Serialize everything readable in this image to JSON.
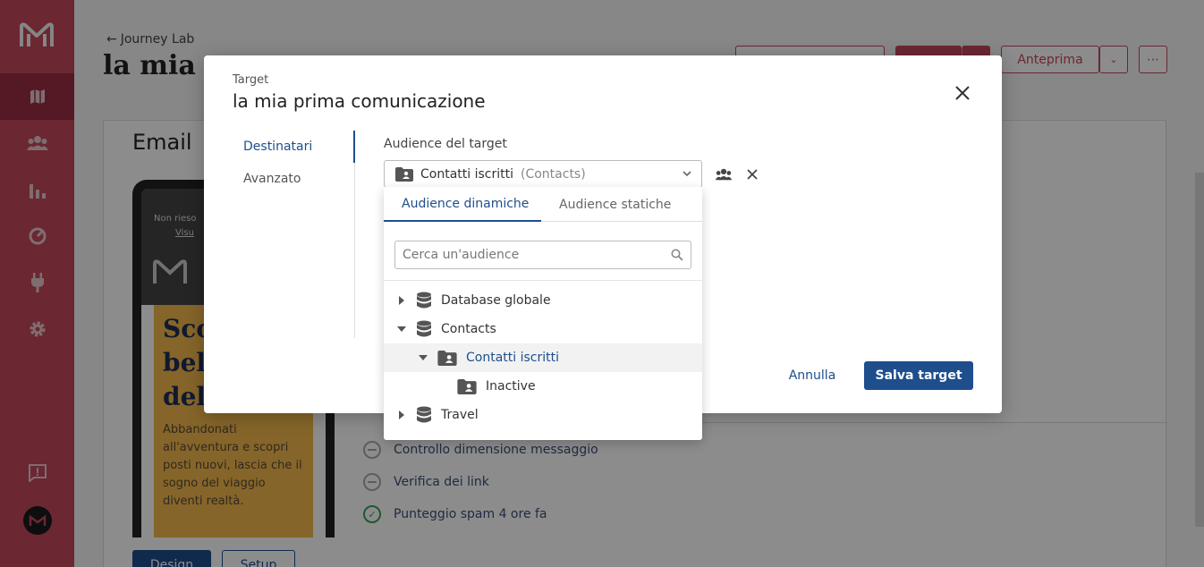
{
  "background": {
    "back_link": "Journey Lab",
    "page_title": "la mia p",
    "top_buttons": {
      "preview_label": "Anteprima"
    },
    "email_label": "Email",
    "phone_preview": {
      "top_line1": "Non rieso",
      "top_line2": "Visu",
      "headline": "Sco bel del",
      "body_text": "Abbandonati all'avventura e scopri posti nuovi, lascia che il sogno del viaggio diventi realtà."
    },
    "checks": [
      {
        "label": "Controllo dimensione messaggio",
        "status": "pending"
      },
      {
        "label": "Verifica dei link",
        "status": "pending"
      },
      {
        "label": "Punteggio spam 4 ore fa",
        "status": "ok"
      }
    ],
    "bottom_buttons": {
      "design_label": "Design",
      "setup_label": "Setup"
    }
  },
  "modal": {
    "eyebrow": "Target",
    "title": "la mia prima comunicazione",
    "nav": {
      "recipients_label": "Destinatari",
      "advanced_label": "Avanzato"
    },
    "audience_field_label": "Audience del target",
    "selected_audience": {
      "name": "Contatti iscritti",
      "source": "(Contacts)"
    },
    "cancel_label": "Annulla",
    "save_label": "Salva target"
  },
  "dropdown": {
    "tabs": {
      "dynamic_label": "Audience dinamiche",
      "static_label": "Audience statiche"
    },
    "search_placeholder": "Cerca un'audience",
    "tree": {
      "database_global": "Database globale",
      "contacts": "Contacts",
      "contacts_subscribed": "Contatti iscritti",
      "inactive": "Inactive",
      "travel": "Travel"
    }
  },
  "colors": {
    "sidebar": "#c4475b",
    "sidebar_active": "#9a2f42",
    "primary": "#1e4e8c",
    "accent_red": "#c4475b"
  }
}
